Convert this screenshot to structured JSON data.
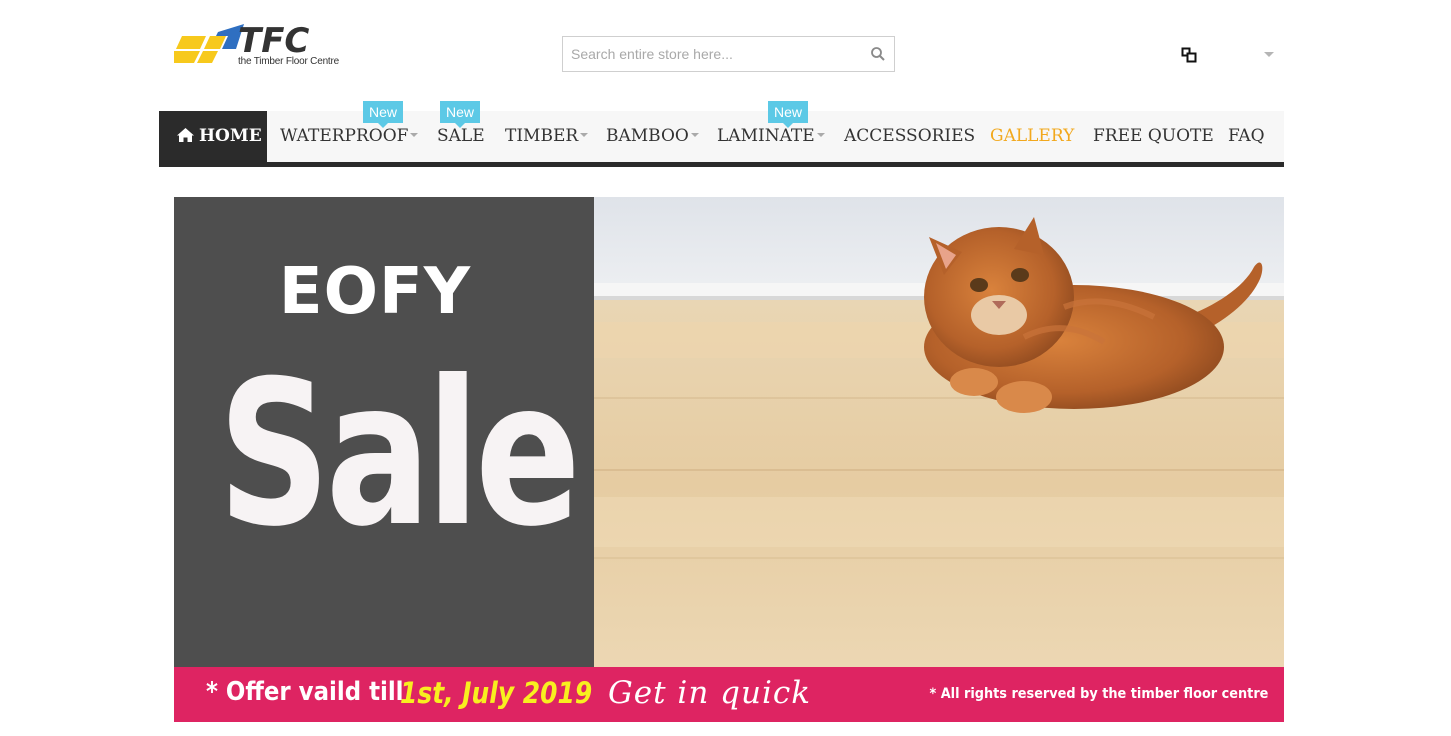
{
  "header": {
    "logo_text": "TFC",
    "logo_tagline": "the Timber Floor Centre",
    "search_placeholder": "Search entire store here...",
    "search_icon": "search-icon",
    "compare_icon": "compare-icon"
  },
  "nav": {
    "items": [
      {
        "label": "HOME",
        "icon": "home-icon",
        "active": true
      },
      {
        "label": "WATERPROOF",
        "badge": "New",
        "dropdown": true
      },
      {
        "label": "SALE",
        "badge": "New"
      },
      {
        "label": "TIMBER",
        "dropdown": true
      },
      {
        "label": "BAMBOO",
        "dropdown": true
      },
      {
        "label": "LAMINATE",
        "badge": "New",
        "dropdown": true
      },
      {
        "label": "ACCESSORIES"
      },
      {
        "label": "GALLERY",
        "highlight": true
      },
      {
        "label": "FREE QUOTE"
      },
      {
        "label": "FAQ"
      }
    ]
  },
  "banner": {
    "eofy": "EOFY",
    "sale": "Sale",
    "offer": "* Offer vaild till",
    "offer_date": "1st, July 2019",
    "get_in": "Get in quick",
    "rights": "* All rights reserved by the timber floor centre"
  },
  "colors": {
    "nav_active_bg": "#2b2b2b",
    "badge": "#5cc9e6",
    "gallery": "#f2a81d",
    "banner_left": "#4e4e4e",
    "banner_footer": "#de2462",
    "offer_date": "#f8ef1f",
    "logo_yellow": "#f7c91c",
    "logo_blue": "#2f6fc1"
  }
}
